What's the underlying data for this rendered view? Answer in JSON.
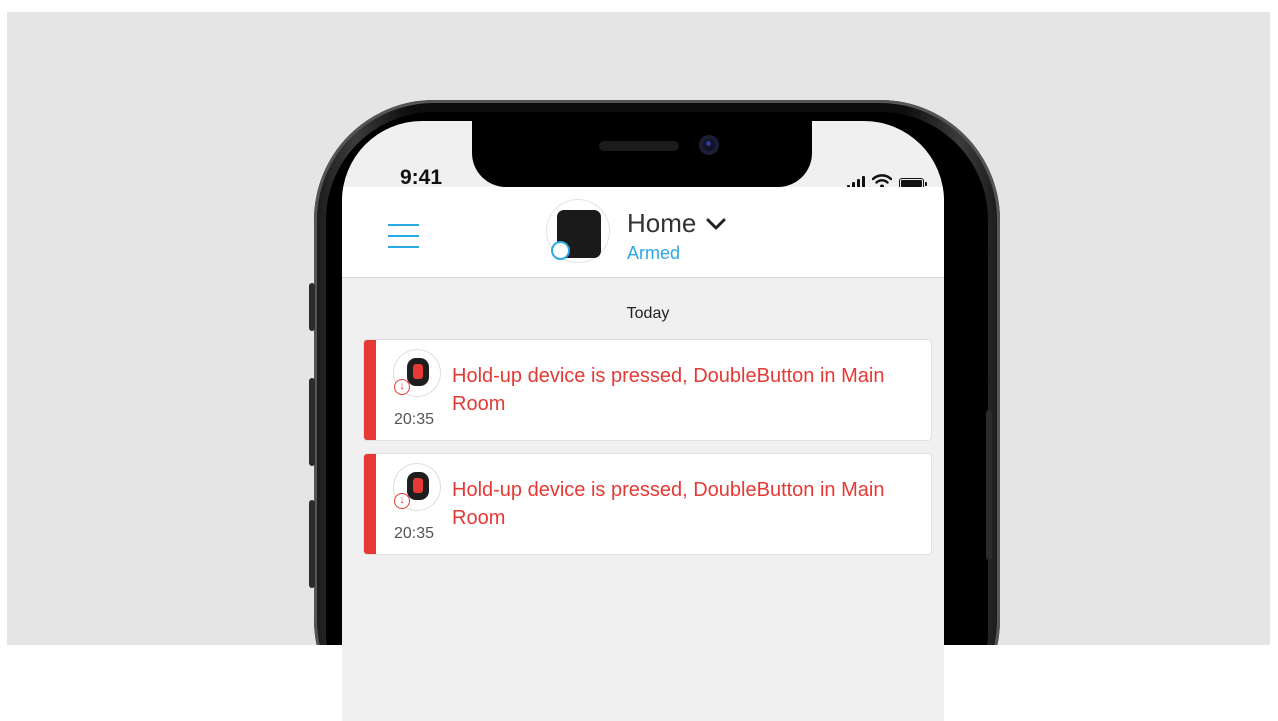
{
  "status_bar": {
    "time": "9:41"
  },
  "header": {
    "hub_name": "Home",
    "hub_status": "Armed"
  },
  "feed": {
    "section_title": "Today",
    "events": [
      {
        "text": "Hold-up device is pressed, DoubleButton in Main Room",
        "time": "20:35"
      },
      {
        "text": "Hold-up device is pressed, DoubleButton in Main Room",
        "time": "20:35"
      }
    ]
  },
  "icons": {
    "menu": "hamburger-icon",
    "hub": "hub-icon",
    "dropdown": "chevron-down-icon",
    "device": "doublebutton-icon",
    "alarm": "arrow-down-circle-icon",
    "signal": "signal-icon",
    "wifi": "wifi-icon",
    "battery": "battery-icon"
  },
  "colors": {
    "accent": "#2ba8e6",
    "alarm": "#e53935",
    "background": "#e5e5e5"
  }
}
